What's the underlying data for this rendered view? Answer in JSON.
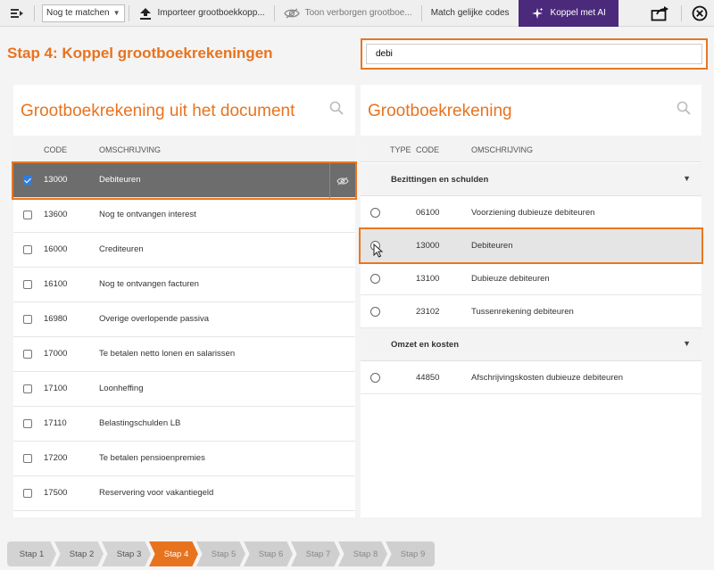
{
  "toolbar": {
    "filter_value": "Nog te matchen",
    "import_label": "Importeer grootboekkopp...",
    "show_hidden_label": "Toon verborgen grootboe...",
    "match_label": "Match gelijke codes",
    "ai_label": "Koppel met AI"
  },
  "header": {
    "title": "Stap 4: Koppel grootboekrekeningen",
    "search_value": "debi"
  },
  "left_panel": {
    "title": "Grootboekrekening uit het document",
    "columns": {
      "code": "CODE",
      "description": "OMSCHRIJVING"
    },
    "rows": [
      {
        "code": "13000",
        "description": "Debiteuren",
        "checked": true
      },
      {
        "code": "13600",
        "description": "Nog te ontvangen interest",
        "checked": false
      },
      {
        "code": "16000",
        "description": "Crediteuren",
        "checked": false
      },
      {
        "code": "16100",
        "description": "Nog te ontvangen facturen",
        "checked": false
      },
      {
        "code": "16980",
        "description": "Overige overlopende passiva",
        "checked": false
      },
      {
        "code": "17000",
        "description": "Te betalen netto lonen en salarissen",
        "checked": false
      },
      {
        "code": "17100",
        "description": "Loonheffing",
        "checked": false
      },
      {
        "code": "17110",
        "description": "Belastingschulden LB",
        "checked": false
      },
      {
        "code": "17200",
        "description": "Te betalen pensioenpremies",
        "checked": false
      },
      {
        "code": "17500",
        "description": "Reservering voor vakantiegeld",
        "checked": false
      }
    ]
  },
  "right_panel": {
    "title": "Grootboekrekening",
    "columns": {
      "type": "TYPE",
      "code": "CODE",
      "description": "OMSCHRIJVING"
    },
    "groups": [
      {
        "label": "Bezittingen en schulden",
        "rows": [
          {
            "code": "06100",
            "description": "Voorziening dubieuze debiteuren"
          },
          {
            "code": "13000",
            "description": "Debiteuren"
          },
          {
            "code": "13100",
            "description": "Dubieuze debiteuren"
          },
          {
            "code": "23102",
            "description": "Tussenrekening debiteuren"
          }
        ]
      },
      {
        "label": "Omzet en kosten",
        "rows": [
          {
            "code": "44850",
            "description": "Afschrijvingskosten dubieuze debiteuren"
          }
        ]
      }
    ]
  },
  "stepper": {
    "steps": [
      "Stap 1",
      "Stap 2",
      "Stap 3",
      "Stap 4",
      "Stap 5",
      "Stap 6",
      "Stap 7",
      "Stap 8",
      "Stap 9"
    ],
    "active_index": 3
  },
  "colors": {
    "accent": "#e8731f",
    "ai_button": "#4b2a7b",
    "selected_row": "#6d6d6d"
  }
}
